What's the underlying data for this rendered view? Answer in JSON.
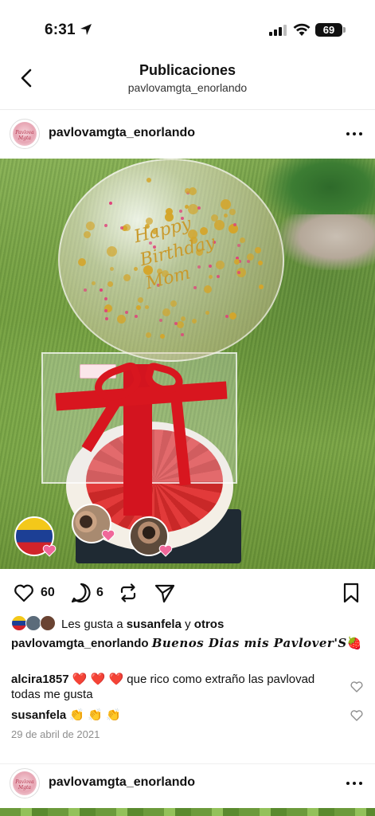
{
  "status_bar": {
    "time": "6:31",
    "battery": "69"
  },
  "nav": {
    "title": "Publicaciones",
    "subtitle": "pavlovamgta_enorlando"
  },
  "post": {
    "username": "pavlovamgta_enorlando",
    "avatar_text": "Pavlova Mgta",
    "balloon_text": [
      "Happy",
      "Birthday",
      "Mom"
    ],
    "like_count": "60",
    "comment_count": "6",
    "likes": {
      "prefix": "Les gusta a",
      "user": "susanfela",
      "conj": "y",
      "others": "otros"
    },
    "caption": {
      "user": "pavlovamgta_enorlando",
      "text": "𝑩𝒖𝒆𝒏𝒐𝒔 𝑫𝒊𝒂𝒔 𝒎𝒊𝒔 𝑷𝒂𝒗𝒍𝒐𝒗𝒆𝒓'𝑺",
      "emoji": "🍓"
    },
    "comments": [
      {
        "user": "alcira1857",
        "text": "❤️ ❤️ ❤️ que rico como extraño las pavlovad todas me gusta"
      },
      {
        "user": "susanfela",
        "text": "👏 👏 👏"
      }
    ],
    "date": "29 de abril de 2021"
  },
  "next_post": {
    "username": "pavlovamgta_enorlando",
    "avatar_text": "Pavlova Mgta"
  },
  "colors": {
    "like_heart_red": "#ff3040",
    "ribbon": "#d8161f",
    "muted": "#8e8e8e"
  }
}
